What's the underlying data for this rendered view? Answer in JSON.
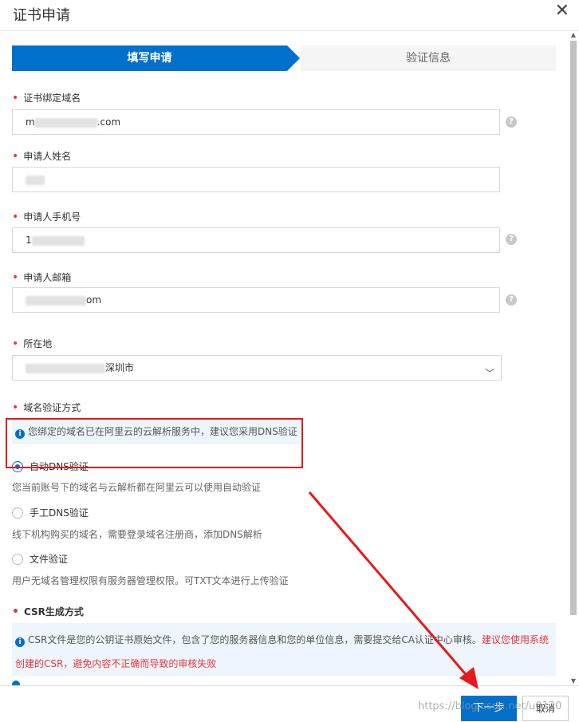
{
  "dialog": {
    "title": "证书申请"
  },
  "steps": [
    {
      "label": "填写申请"
    },
    {
      "label": "验证信息"
    }
  ],
  "form": {
    "domain": {
      "label": "证书绑定域名",
      "value_prefix": "m",
      "value_suffix": ".com"
    },
    "name": {
      "label": "申请人姓名"
    },
    "phone": {
      "label": "申请人手机号",
      "value_prefix": "1"
    },
    "email": {
      "label": "申请人邮箱",
      "value_suffix": "om"
    },
    "location": {
      "label": "所在地",
      "value_suffix": "深圳市"
    },
    "verify_method": {
      "label": "域名验证方式",
      "notice": "您绑定的域名已在阿里云的云解析服务中，建议您采用DNS验证",
      "options": [
        {
          "label": "自动DNS验证",
          "desc": "您当前账号下的域名与云解析都在阿里云可以使用自动验证",
          "checked": true
        },
        {
          "label": "手工DNS验证",
          "desc": "线下机构购买的域名，需要登录域名注册商，添加DNS解析",
          "checked": false
        },
        {
          "label": "文件验证",
          "desc": "用户无域名管理权限有服务器管理权限。可TXT文本进行上传验证",
          "checked": false
        }
      ]
    },
    "csr": {
      "label": "CSR生成方式",
      "notice": "CSR文件是您的公钥证书原始文件，包含了您的服务器信息和您的单位信息，需要提交给CA认证中心审核。",
      "notice_red_1": "建议您使用系统",
      "notice_red_2": "创建的CSR，避免内容不正确而导致的审核失败"
    }
  },
  "footer": {
    "next_label": "下一步",
    "cancel_label": "取消"
  },
  "watermark": "https://blog.csdn.net/u0120",
  "colors": {
    "primary": "#0070cc",
    "required": "#e4393c",
    "annotation": "#e61a1a"
  }
}
